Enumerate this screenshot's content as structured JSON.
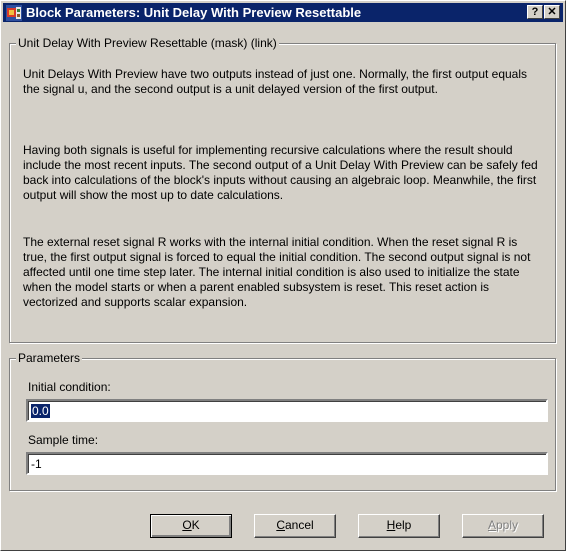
{
  "window": {
    "title": "Block Parameters: Unit Delay With Preview Resettable",
    "help_glyph": "?",
    "close_glyph": "✕"
  },
  "description": {
    "group_title": "Unit Delay With Preview Resettable (mask) (link)",
    "paragraphs": [
      "Unit Delays With Preview have two outputs instead of just one.  Normally, the first output equals the signal u, and the second output is a unit delayed version of the first output.",
      "Having both signals is useful for implementing recursive calculations where the result should include the most recent inputs.  The second output of a Unit Delay With Preview can be safely fed back into calculations of the block's inputs without causing an algebraic loop.  Meanwhile, the first output will show the most up to date calculations.",
      "The external reset signal R works with the internal initial condition.  When the reset signal R is true, the first output signal is forced to equal the initial condition.  The second output signal is not affected until one time step later.  The internal initial condition is also used to initialize the state when the model starts or when a parent enabled subsystem is reset.  This reset action is vectorized and supports scalar expansion."
    ]
  },
  "parameters": {
    "group_title": "Parameters",
    "initial_condition": {
      "label": "Initial condition:",
      "value": "0.0"
    },
    "sample_time": {
      "label": "Sample time:",
      "value": "-1"
    }
  },
  "buttons": {
    "ok": {
      "mnemonic": "O",
      "rest": "K"
    },
    "cancel": {
      "mnemonic": "C",
      "rest": "ancel"
    },
    "help": {
      "mnemonic": "H",
      "rest": "elp"
    },
    "apply": {
      "mnemonic": "A",
      "rest": "pply",
      "enabled": false
    }
  },
  "colors": {
    "title_bar": "#0a246a",
    "dialog_face": "#d4d0c8",
    "selection": "#0a246a"
  },
  "icons": {
    "window_icon": "simulink-block-icon",
    "help": "help-question-icon",
    "close": "close-icon"
  }
}
